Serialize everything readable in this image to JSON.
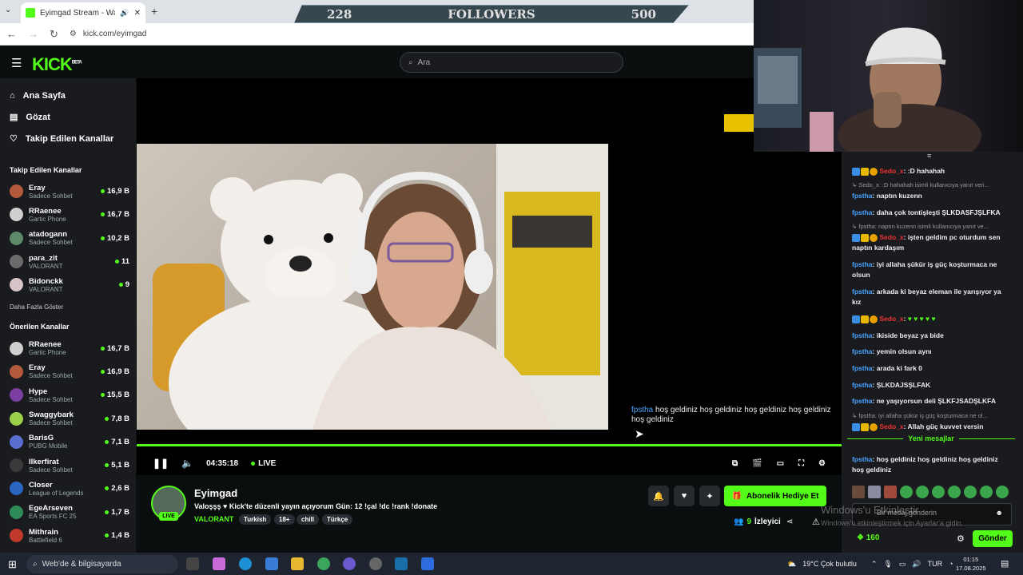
{
  "browser": {
    "tab_title": "Eyimgad Stream - Watch Li",
    "url": "kick.com/eyimgad"
  },
  "overlay": {
    "followers_current": "228",
    "followers_label": "FOLLOWERS",
    "followers_goal": "500"
  },
  "header": {
    "logo": "KICK",
    "logo_beta": "BETA",
    "search_placeholder": "Ara"
  },
  "sidebar": {
    "nav": [
      {
        "label": "Ana Sayfa",
        "icon": "home-icon"
      },
      {
        "label": "Gözat",
        "icon": "browse-icon"
      },
      {
        "label": "Takip Edilen Kanallar",
        "icon": "heart-icon"
      }
    ],
    "followed_title": "Takip Edilen Kanallar",
    "followed": [
      {
        "name": "Eray",
        "game": "Sadece Sohbet",
        "viewers": "16,9 B",
        "color": "#b45a3c"
      },
      {
        "name": "RRaenee",
        "game": "Gartic Phone",
        "viewers": "16,7 B",
        "color": "#cfcfcf"
      },
      {
        "name": "atadogann",
        "game": "Sadece Sohbet",
        "viewers": "10,2 B",
        "color": "#5c8a6a"
      },
      {
        "name": "para_zit",
        "game": "VALORANT",
        "viewers": "11",
        "color": "#6b6b6b"
      },
      {
        "name": "Bidonckk",
        "game": "VALORANT",
        "viewers": "9",
        "color": "#d8c4c8"
      }
    ],
    "show_more": "Daha Fazla Göster",
    "recommended_title": "Önerilen Kanallar",
    "recommended": [
      {
        "name": "RRaenee",
        "game": "Gartic Phone",
        "viewers": "16,7 B",
        "color": "#cfcfcf"
      },
      {
        "name": "Eray",
        "game": "Sadece Sohbet",
        "viewers": "16,9 B",
        "color": "#b45a3c"
      },
      {
        "name": "Hype",
        "game": "Sadece Sohbet",
        "viewers": "15,5 B",
        "color": "#7a3fa0"
      },
      {
        "name": "Swaggybark",
        "game": "Sadece Sohbet",
        "viewers": "7,8 B",
        "color": "#9bd04a"
      },
      {
        "name": "BarisG",
        "game": "PUBG Mobile",
        "viewers": "7,1 B",
        "color": "#5a6fd0"
      },
      {
        "name": "Ilkerfirat",
        "game": "Sadece Sohbet",
        "viewers": "5,1 B",
        "color": "#3a3a3a"
      },
      {
        "name": "Closer",
        "game": "League of Legends",
        "viewers": "2,6 B",
        "color": "#2a66c0"
      },
      {
        "name": "EgeArseven",
        "game": "EA Sports FC 25",
        "viewers": "1,7 B",
        "color": "#2e8b57"
      },
      {
        "name": "Mithrain",
        "game": "Battlefield 6",
        "viewers": "1,4 B",
        "color": "#c0392b"
      }
    ]
  },
  "player": {
    "time": "04:35:18",
    "live_label": "LIVE"
  },
  "overlay_chat": {
    "user": "fpstha",
    "text": "hoş geldiniz hoş geldiniz hoş geldiniz hoş geldiniz hoş geldiniz"
  },
  "stream": {
    "name": "Eyimgad",
    "live_badge": "LIVE",
    "title": "Valoşşş ♥ Kick'te düzenli yayın açıyorum Gün: 12  !çal !dc !rank !donate",
    "game": "VALORANT",
    "tags": [
      "Turkish",
      "18+",
      "chill",
      "Türkçe"
    ],
    "sub_gift": "Abonelik Hediye Et",
    "viewers_count": "9",
    "viewers_label": "İzleyici"
  },
  "chat": {
    "messages": [
      {
        "reply": "",
        "user": "Sedo_x",
        "user_color": "red",
        "text": ":D hahahah",
        "badges": true
      },
      {
        "reply": "↳ Sedo_x: :D hahahah isimli kullanıcıya yanıt veri...",
        "user": "fpstha",
        "user_color": "blue",
        "text": "naptın kuzenn",
        "badges": false
      },
      {
        "reply": "",
        "user": "fpstha",
        "user_color": "blue",
        "text": "daha çok tontişleşti ŞLKDASFJŞLFKA",
        "badges": false
      },
      {
        "reply": "↳ fpstha: naptın kuzenn isimli kullanıcıya yanıt ve...",
        "user": "Sedo_x",
        "user_color": "red",
        "text": "işten geldim pc oturdum sen naptın kardaşım",
        "badges": true
      },
      {
        "reply": "",
        "user": "fpstha",
        "user_color": "blue",
        "text": "iyi allaha şükür iş güç koşturmaca ne olsun",
        "badges": false
      },
      {
        "reply": "",
        "user": "fpstha",
        "user_color": "blue",
        "text": "arkada ki beyaz eleman ile yarışıyor ya kız",
        "badges": false
      },
      {
        "reply": "",
        "user": "Sedo_x",
        "user_color": "red",
        "text": "♥ ♥ ♥ ♥ ♥",
        "badges": true
      },
      {
        "reply": "",
        "user": "fpstha",
        "user_color": "blue",
        "text": "ikiside beyaz ya bide",
        "badges": false
      },
      {
        "reply": "",
        "user": "fpstha",
        "user_color": "blue",
        "text": "yemin olsun aynı",
        "badges": false
      },
      {
        "reply": "",
        "user": "fpstha",
        "user_color": "blue",
        "text": "arada ki fark 0",
        "badges": false
      },
      {
        "reply": "",
        "user": "fpstha",
        "user_color": "blue",
        "text": "ŞLKDAJSŞLFAK",
        "badges": false
      },
      {
        "reply": "",
        "user": "fpstha",
        "user_color": "blue",
        "text": "ne yaşıyorsun deli ŞLKFJSADŞLKFA",
        "badges": false
      },
      {
        "reply": "↳ fpstha: iyi allaha şükür iş güç koşturmaca ne ol...",
        "user": "Sedo_x",
        "user_color": "red",
        "text": "Allah güç kuvvet versin",
        "badges": true
      }
    ],
    "new_messages_label": "Yeni mesajlar",
    "last_user": "fpstha",
    "last_text": "hoş geldiniz hoş geldiniz hoş geldiniz hoş geldiniz",
    "input_placeholder": "Bir mesaj gönderin",
    "points": "160",
    "send_label": "Gönder"
  },
  "watermark": {
    "title": "Windows'u Etkinleştir",
    "subtitle": "Windows'u etkinleştirmek için Ayarlar'a gidin."
  },
  "taskbar": {
    "search_placeholder": "Web'de & bilgisayarda",
    "weather": "19°C  Çok bulutlu",
    "lang": "TUR",
    "time": "01:15",
    "date": "17.08.2025"
  }
}
